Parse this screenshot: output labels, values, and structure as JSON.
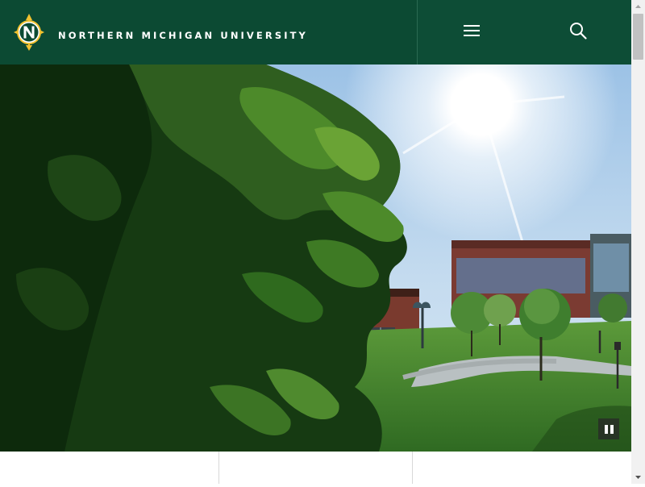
{
  "header": {
    "logo_icon": "northern-n-compass-logo-icon",
    "site_name": "NORTHERN MICHIGAN UNIVERSITY",
    "menu_icon": "hamburger-menu-icon",
    "search_icon": "search-icon"
  },
  "hero": {
    "media": "campus video still",
    "pause_icon": "pause-icon"
  },
  "colors": {
    "brand_green": "#0c4a33",
    "logo_gold": "#f2c230"
  }
}
